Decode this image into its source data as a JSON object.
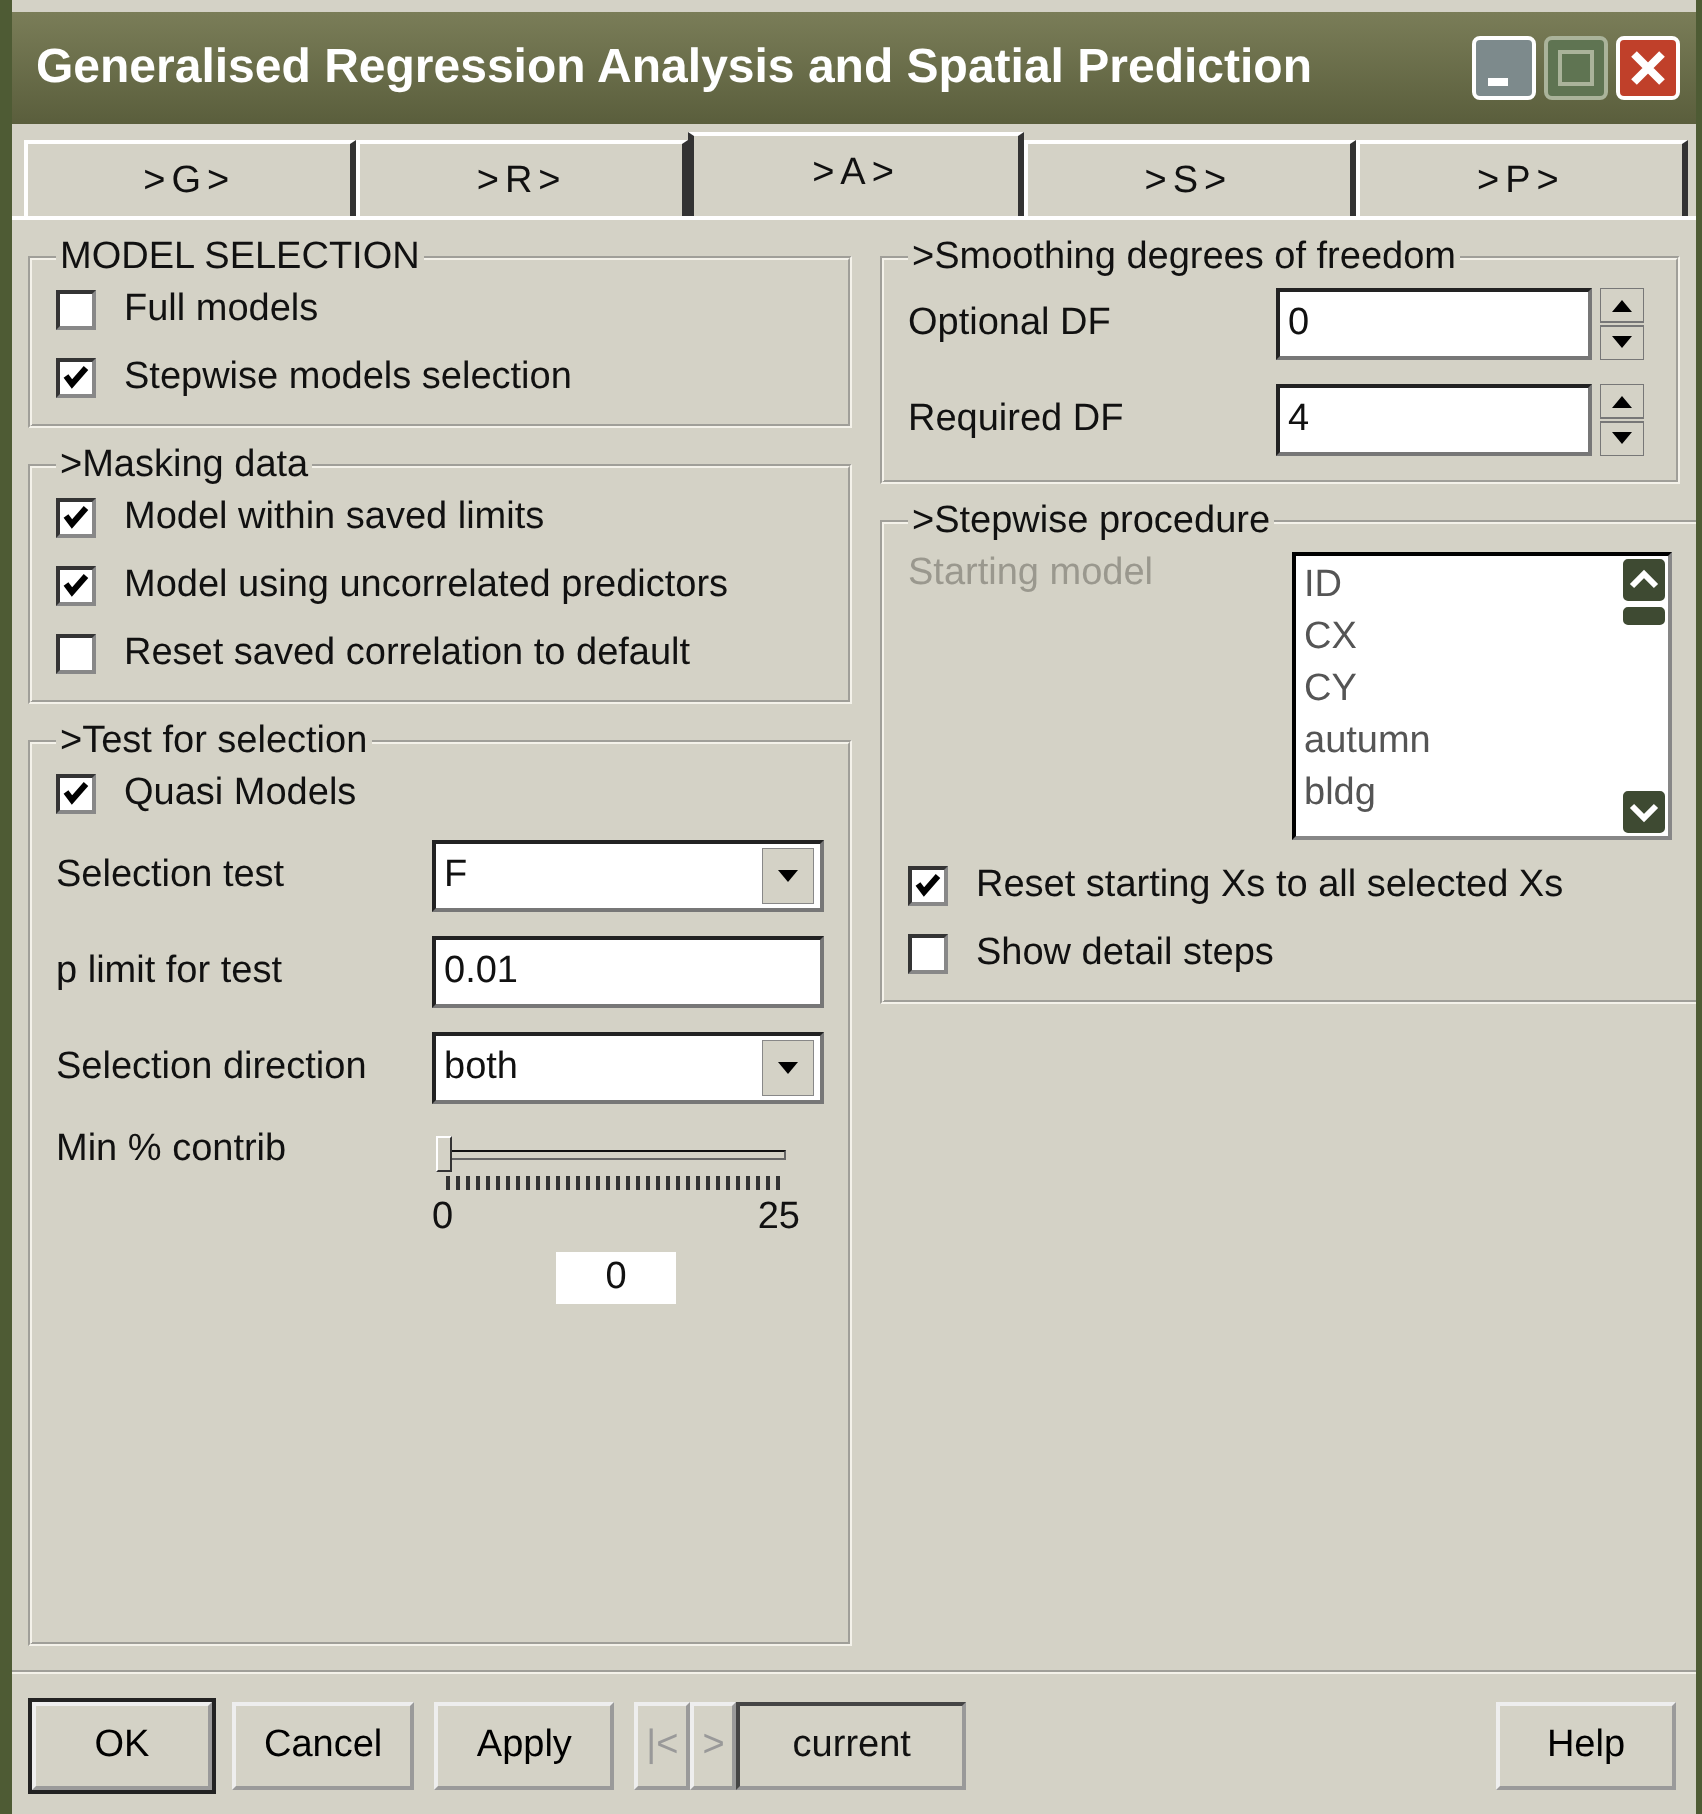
{
  "window": {
    "title": "Generalised Regression Analysis and Spatial Prediction"
  },
  "tabs": [
    {
      "label": ">G>",
      "selected": false
    },
    {
      "label": ">R>",
      "selected": false
    },
    {
      "label": ">A>",
      "selected": true
    },
    {
      "label": ">S>",
      "selected": false
    },
    {
      "label": ">P>",
      "selected": false
    }
  ],
  "model_selection": {
    "title": "MODEL SELECTION",
    "options": [
      {
        "label": "Full models",
        "checked": false
      },
      {
        "label": "Stepwise models selection",
        "checked": true
      }
    ]
  },
  "masking": {
    "title": ">Masking data",
    "options": [
      {
        "label": "Model within saved limits",
        "checked": true
      },
      {
        "label": "Model using uncorrelated predictors",
        "checked": true
      },
      {
        "label": "Reset saved correlation to default",
        "checked": false
      }
    ]
  },
  "test": {
    "title": ">Test for selection",
    "options": [
      {
        "label": "Quasi Models",
        "checked": true
      }
    ],
    "fields": [
      {
        "kind": "dropdown",
        "label": "Selection test",
        "value": "F"
      },
      {
        "kind": "text",
        "label": "p limit for test",
        "value": "0.01"
      },
      {
        "kind": "dropdown",
        "label": "Selection direction",
        "value": "both"
      }
    ],
    "slider": {
      "label": "Min % contrib",
      "level": 0,
      "min": "0",
      "max": "25",
      "value": "0"
    }
  },
  "smoothing": {
    "title": ">Smoothing degrees of freedom",
    "fields": [
      {
        "label": "Optional DF",
        "value": "0"
      },
      {
        "label": "Required DF",
        "value": "4"
      }
    ]
  },
  "stepwise": {
    "title": ">Stepwise procedure",
    "starting_model": {
      "label": "Starting model",
      "disabled": true,
      "items": [
        "ID",
        "CX",
        "CY",
        "autumn",
        "bldg"
      ]
    },
    "options": [
      {
        "label": "Reset starting Xs to all selected Xs",
        "checked": true
      },
      {
        "label": "Show detail steps",
        "checked": false
      }
    ]
  },
  "footer": {
    "left": [
      {
        "kind": "button",
        "label": "OK",
        "default": true
      },
      {
        "kind": "button",
        "label": "Cancel",
        "default": false
      },
      {
        "kind": "button",
        "label": "Apply",
        "default": false
      },
      {
        "kind": "nav",
        "label": "|<",
        "disabled": true
      },
      {
        "kind": "nav",
        "label": ">",
        "disabled": true
      },
      {
        "kind": "display",
        "label": "current"
      }
    ],
    "right": [
      {
        "kind": "button",
        "label": "Help",
        "default": false
      }
    ]
  }
}
